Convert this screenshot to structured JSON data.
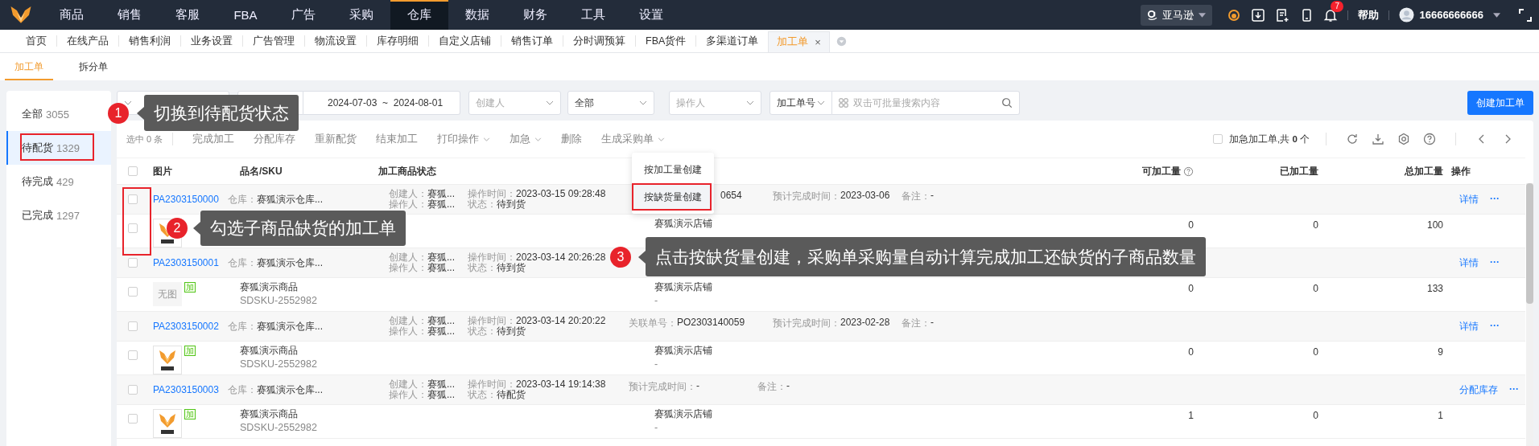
{
  "nav": {
    "items": [
      {
        "label": "商品",
        "selected": false
      },
      {
        "label": "销售",
        "selected": false
      },
      {
        "label": "客服",
        "selected": false
      },
      {
        "label": "FBA",
        "selected": false
      },
      {
        "label": "广告",
        "selected": false
      },
      {
        "label": "采购",
        "selected": false
      },
      {
        "label": "仓库",
        "selected": true
      },
      {
        "label": "数据",
        "selected": false
      },
      {
        "label": "财务",
        "selected": false
      },
      {
        "label": "工具",
        "selected": false
      },
      {
        "label": "设置",
        "selected": false
      }
    ],
    "platform": "亚马逊",
    "notifications": "7",
    "help": "帮助",
    "user": "16666666666"
  },
  "tabs": [
    {
      "label": "首页",
      "selected": false
    },
    {
      "label": "在线产品",
      "selected": false
    },
    {
      "label": "销售利润",
      "selected": false
    },
    {
      "label": "业务设置",
      "selected": false
    },
    {
      "label": "广告管理",
      "selected": false
    },
    {
      "label": "物流设置",
      "selected": false
    },
    {
      "label": "库存明细",
      "selected": false
    },
    {
      "label": "自定义店铺",
      "selected": false
    },
    {
      "label": "销售订单",
      "selected": false
    },
    {
      "label": "分时调预算",
      "selected": false
    },
    {
      "label": "FBA货件",
      "selected": false
    },
    {
      "label": "多渠道订单",
      "selected": false
    },
    {
      "label": "加工单",
      "selected": true,
      "close": "×"
    }
  ],
  "subtabs": [
    {
      "label": "加工单",
      "selected": true
    },
    {
      "label": "拆分单",
      "selected": false
    }
  ],
  "sidebar": [
    {
      "label": "全部",
      "count": "3055",
      "selected": false
    },
    {
      "label": "待配货",
      "count": "1329",
      "selected": true
    },
    {
      "label": "待完成",
      "count": "429",
      "selected": false
    },
    {
      "label": "已完成",
      "count": "1297",
      "selected": false
    }
  ],
  "filters": [
    {
      "kind": "select"
    },
    {
      "kind": "date-range",
      "start": "2024-07-03",
      "separator": "~",
      "end": "2024-08-01"
    },
    {
      "kind": "select",
      "placeholder": "创建人"
    },
    {
      "kind": "select",
      "value": "全部"
    },
    {
      "kind": "select",
      "placeholder": "操作人"
    },
    {
      "kind": "search",
      "type_value": "加工单号",
      "placeholder": "双击可批量搜索内容"
    }
  ],
  "create_button": "创建加工单",
  "toolbar": {
    "selected_count": "选中 0 条",
    "actions": [
      {
        "label": "完成加工",
        "dropdown": false
      },
      {
        "label": "分配库存",
        "dropdown": false
      },
      {
        "label": "重新配货",
        "dropdown": false
      },
      {
        "label": "结束加工",
        "dropdown": false
      },
      {
        "label": "打印操作",
        "dropdown": true
      },
      {
        "label": "加急",
        "dropdown": true
      },
      {
        "label": "删除",
        "dropdown": false
      },
      {
        "label": "生成采购单",
        "dropdown": true
      }
    ],
    "urgent": {
      "checked": false,
      "label": "加急加工单,共 **0** 个"
    }
  },
  "table": {
    "all_checked": false,
    "columns": [
      "图片",
      "品名/SKU",
      "加工商品状态",
      "可加工量",
      "已加工量",
      "总加工量",
      "操作"
    ]
  },
  "menu": [
    {
      "label": "按加工量创建",
      "selected": false
    },
    {
      "label": "按缺货量创建",
      "selected": true
    }
  ],
  "orders": [
    {
      "checked": false,
      "id": "PA2303150000",
      "warehouse_label": "仓库：",
      "warehouse": "赛狐演示仓库...",
      "creator_label": "创建人：",
      "creator": "赛狐...",
      "operator_label": "操作人：",
      "operator": "赛狐...",
      "time_label": "操作时间：",
      "time": "2023-03-15 09:28:48",
      "status_label": "状态：",
      "status": "待到货",
      "fields": [
        {
          "kind": "ref",
          "value": "0654"
        },
        {
          "kind": "due",
          "label": "预计完成时间：",
          "value": "2023-03-06"
        },
        {
          "kind": "note",
          "label": "备注：",
          "value": "-"
        }
      ],
      "action": "详情",
      "more": "···",
      "item": {
        "checked": false,
        "kind": "picture",
        "store": "赛狐演示店铺",
        "processable": "0",
        "processed": "0",
        "total": "100"
      }
    },
    {
      "checked": false,
      "id": "PA2303150001",
      "warehouse_label": "仓库：",
      "warehouse": "赛狐演示仓库...",
      "creator_label": "创建人：",
      "creator": "赛狐...",
      "operator_label": "操作人：",
      "operator": "赛狐...",
      "time_label": "操作时间：",
      "time": "2023-03-14 20:26:28",
      "status_label": "状态：",
      "status": "待到货",
      "action": "详情",
      "more": "···",
      "item": {
        "checked": false,
        "kind": "no-image",
        "image_text": "无图",
        "badge": "加",
        "name": "赛狐演示商品",
        "sku": "SDSKU-2552982",
        "store": "赛狐演示店铺",
        "store_sub": "-",
        "processable": "0",
        "processed": "0",
        "total": "133"
      }
    },
    {
      "checked": false,
      "id": "PA2303150002",
      "warehouse_label": "仓库：",
      "warehouse": "赛狐演示仓库...",
      "creator_label": "创建人：",
      "creator": "赛狐...",
      "operator_label": "操作人：",
      "operator": "赛狐...",
      "time_label": "操作时间：",
      "time": "2023-03-14 20:20:22",
      "status_label": "状态：",
      "status": "待到货",
      "fields": [
        {
          "kind": "ref",
          "label": "关联单号：",
          "value": "PO2303140059"
        },
        {
          "kind": "due",
          "label": "预计完成时间：",
          "value": "2023-02-28"
        },
        {
          "kind": "note",
          "label": "备注：",
          "value": "-"
        }
      ],
      "action": "详情",
      "more": "···",
      "item": {
        "checked": false,
        "kind": "picture",
        "badge": "加",
        "name": "赛狐演示商品",
        "sku": "SDSKU-2552982",
        "store": "赛狐演示店铺",
        "store_sub": "-",
        "processable": "0",
        "processed": "0",
        "total": "9"
      }
    },
    {
      "checked": false,
      "id": "PA2303150003",
      "warehouse_label": "仓库：",
      "warehouse": "赛狐演示仓库...",
      "creator_label": "创建人：",
      "creator": "赛狐...",
      "operator_label": "操作人：",
      "operator": "赛狐...",
      "time_label": "操作时间：",
      "time": "2023-03-14 19:14:38",
      "status_label": "状态：",
      "status": "待配货",
      "fields": [
        {
          "kind": "due",
          "label": "预计完成时间：",
          "value": "-"
        },
        {
          "kind": "note",
          "label": "备注：",
          "value": "-"
        }
      ],
      "action": "分配库存",
      "more": "···",
      "item": {
        "checked": false,
        "kind": "picture",
        "badge": "加",
        "name": "赛狐演示商品",
        "sku": "SDSKU-2552982",
        "store": "赛狐演示店铺",
        "store_sub": "-",
        "processable": "1",
        "processed": "0",
        "total": "1"
      }
    }
  ],
  "callouts": [
    {
      "number": "1",
      "text": "切换到待配货状态"
    },
    {
      "number": "2",
      "text": "勾选子商品缺货的加工单"
    },
    {
      "number": "3",
      "text": "点击按缺货量创建，采购单采购量自动计算完成加工还缺货的子商品数量"
    }
  ]
}
